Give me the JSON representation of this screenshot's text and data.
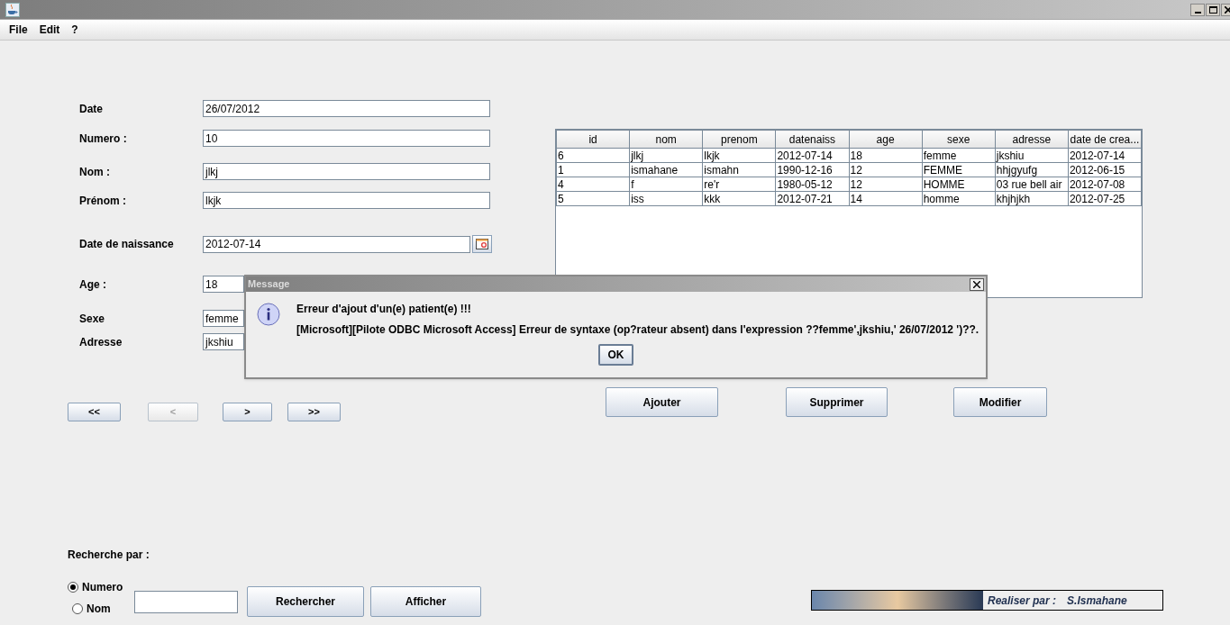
{
  "menu": [
    "File",
    "Edit",
    "?"
  ],
  "form": {
    "fields": [
      {
        "label": "Date",
        "value": "26/07/2012",
        "kind": "text"
      },
      {
        "label": "Numero :",
        "value": "10",
        "kind": "text"
      },
      {
        "label": "Nom :",
        "value": "jlkj",
        "kind": "text"
      },
      {
        "label": "Prénom :",
        "value": "lkjk",
        "kind": "text"
      },
      {
        "label": "Date de naissance",
        "value": "2012-07-14",
        "kind": "date"
      },
      {
        "label": "Age :",
        "value": "18",
        "kind": "text"
      },
      {
        "label": "Sexe",
        "value": "femme",
        "kind": "text"
      },
      {
        "label": "Adresse",
        "value": "jkshiu",
        "kind": "text"
      }
    ]
  },
  "navigation": [
    {
      "label": "<<",
      "disabled": false
    },
    {
      "label": "<",
      "disabled": true
    },
    {
      "label": ">",
      "disabled": false
    },
    {
      "label": ">>",
      "disabled": false
    }
  ],
  "table": {
    "columns": [
      "id",
      "nom",
      "prenom",
      "datenaiss",
      "age",
      "sexe",
      "adresse",
      "date de crea..."
    ],
    "rows": [
      [
        "6",
        "jlkj",
        "lkjk",
        "2012-07-14",
        "18",
        "femme",
        "jkshiu",
        "2012-07-14"
      ],
      [
        "1",
        "ismahane",
        "ismahn",
        "1990-12-16",
        "12",
        "FEMME",
        "hhjgyufg",
        "2012-06-15"
      ],
      [
        "4",
        "f",
        "re'r",
        "1980-05-12",
        "12",
        "HOMME",
        "03 rue bell air",
        "2012-07-08"
      ],
      [
        "5",
        "iss",
        "kkk",
        "2012-07-21",
        "14",
        "homme",
        "khjhjkh",
        "2012-07-25"
      ]
    ]
  },
  "actions": [
    "Ajouter",
    "Supprimer",
    "Modifier"
  ],
  "search": {
    "label": "Recherche par :",
    "options": [
      {
        "label": "Numero",
        "selected": true
      },
      {
        "label": "Nom",
        "selected": false
      }
    ],
    "buttons": [
      "Rechercher",
      "Afficher"
    ]
  },
  "credit": {
    "label": "Realiser par :",
    "author": "S.Ismahane"
  },
  "dialog": {
    "title": "Message",
    "heading": "Erreur d'ajout d'un(e) patient(e) !!!",
    "message": "[Microsoft][Pilote ODBC Microsoft Access] Erreur de syntaxe (op?rateur absent) dans l'expression ??femme',jkshiu,' 26/07/2012 ')??.",
    "button": "OK"
  }
}
